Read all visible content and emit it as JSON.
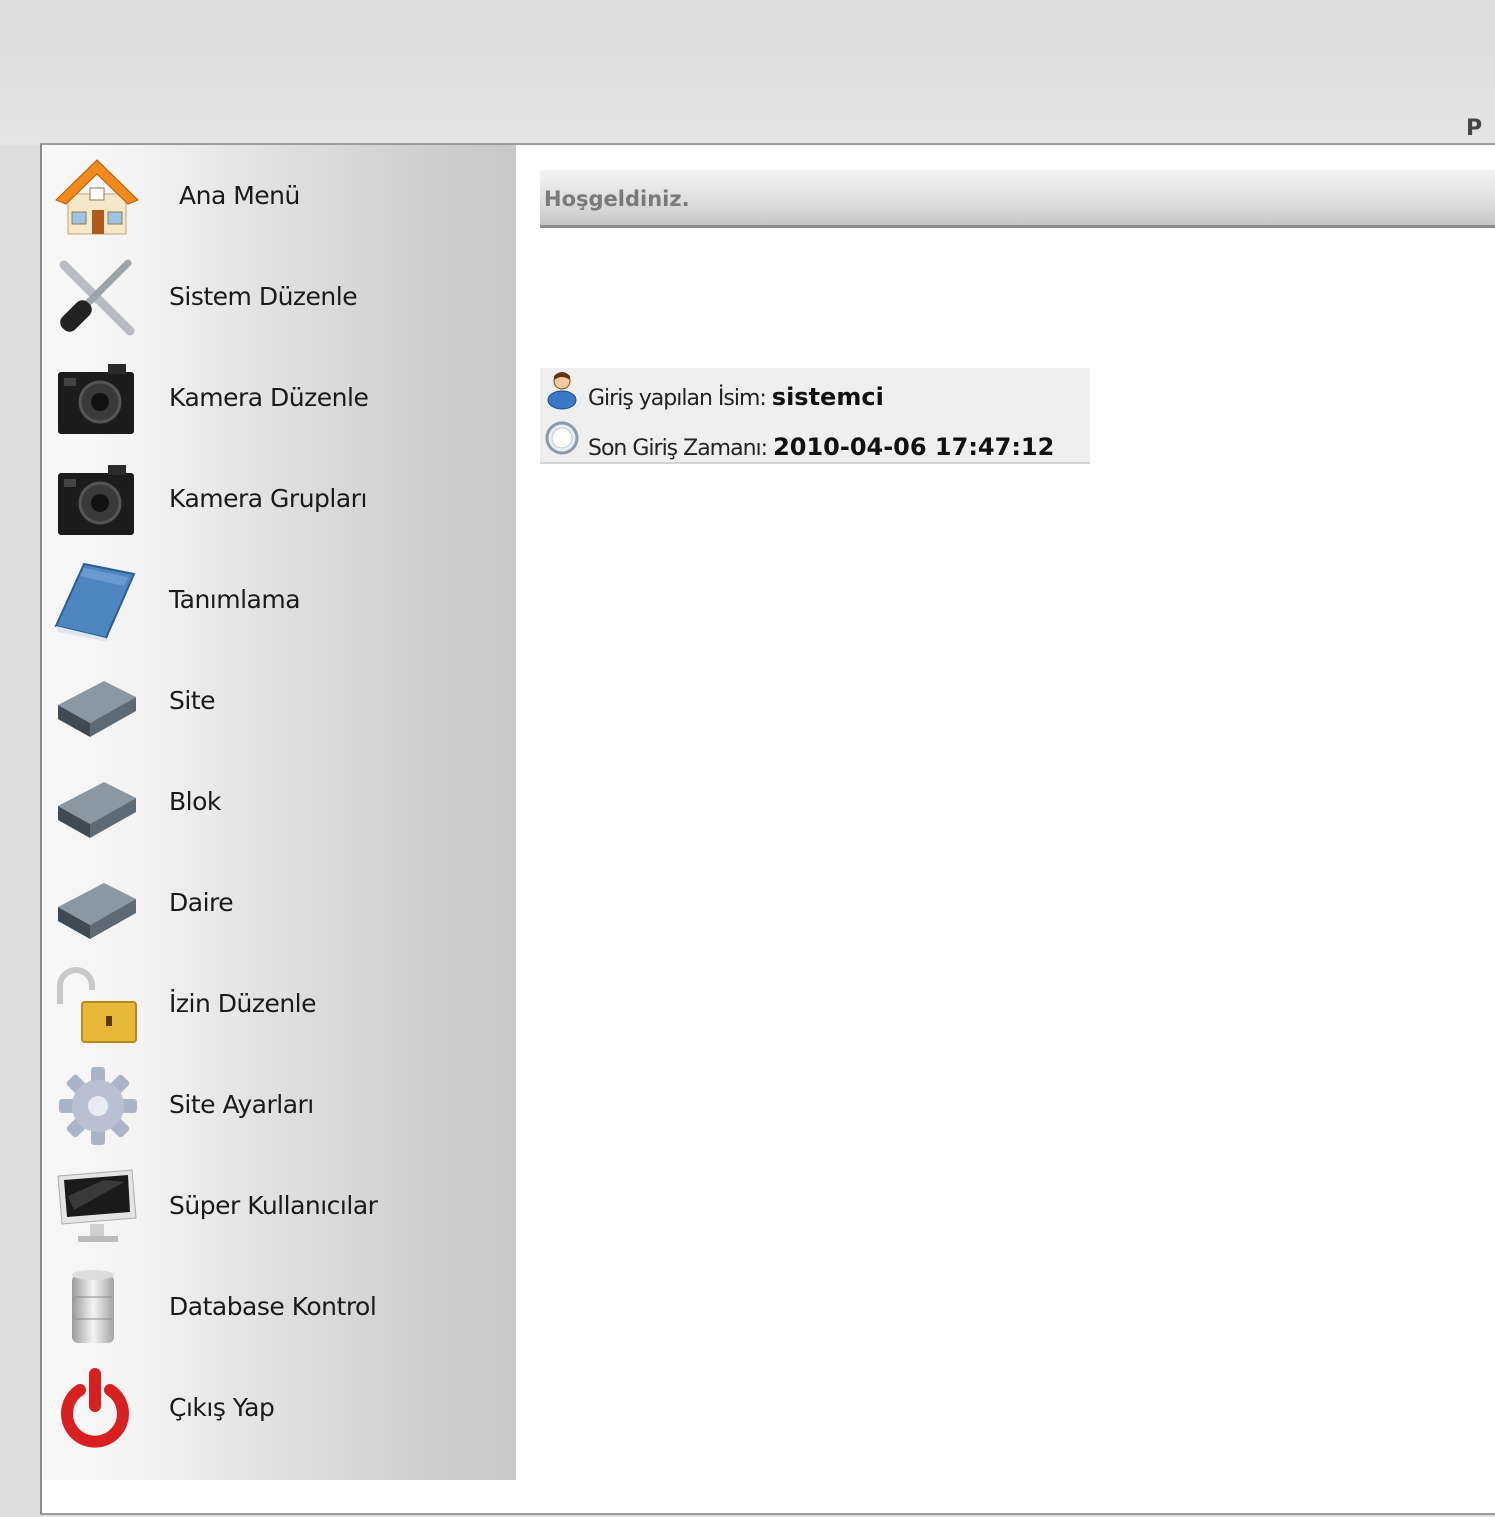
{
  "header": {
    "corner_text": "P"
  },
  "sidebar": {
    "items": [
      {
        "label": "Ana Menü",
        "icon": "home-icon"
      },
      {
        "label": "Sistem Düzenle",
        "icon": "tools-icon"
      },
      {
        "label": "Kamera Düzenle",
        "icon": "camera-icon"
      },
      {
        "label": "Kamera Grupları",
        "icon": "camera-icon"
      },
      {
        "label": "Tanımlama",
        "icon": "book-icon"
      },
      {
        "label": "Site",
        "icon": "drive-icon"
      },
      {
        "label": "Blok",
        "icon": "drive-icon"
      },
      {
        "label": "Daire",
        "icon": "drive-icon"
      },
      {
        "label": "İzin Düzenle",
        "icon": "padlock-icon"
      },
      {
        "label": "Site Ayarları",
        "icon": "gear-icon"
      },
      {
        "label": "Süper Kullanıcılar",
        "icon": "monitor-icon"
      },
      {
        "label": "Database Kontrol",
        "icon": "database-icon"
      },
      {
        "label": "Çıkış Yap",
        "icon": "power-icon"
      }
    ]
  },
  "main": {
    "welcome_title": "Hoşgeldiniz.",
    "info": {
      "user_label": "Giriş yapılan İsim: ",
      "user_value": "sistemci",
      "last_login_label": "Son Giriş Zamanı: ",
      "last_login_value": "2010-04-06 17:47:12"
    }
  },
  "colors": {
    "background": "#dedede",
    "sidebar_light": "#f8f8f8",
    "sidebar_dark": "#c8c8c8",
    "title_text": "#7a7a7a"
  }
}
